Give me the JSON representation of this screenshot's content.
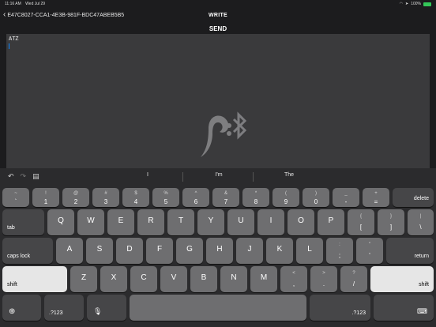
{
  "status": {
    "time": "11:16 AM",
    "date": "Wed Jul 29",
    "battery": "100%"
  },
  "nav": {
    "back_label": "E47C8027-CCA1-4E3B-981F-BDC47ABEB5B5",
    "title": "WRITE"
  },
  "send_label": "SEND",
  "editor": {
    "text": "ATZ"
  },
  "suggestions": [
    "I",
    "I'm",
    "The"
  ],
  "keyboard": {
    "row1": [
      {
        "t": "~",
        "b": "`"
      },
      {
        "t": "!",
        "b": "1"
      },
      {
        "t": "@",
        "b": "2"
      },
      {
        "t": "#",
        "b": "3"
      },
      {
        "t": "$",
        "b": "4"
      },
      {
        "t": "%",
        "b": "5"
      },
      {
        "t": "^",
        "b": "6"
      },
      {
        "t": "&",
        "b": "7"
      },
      {
        "t": "*",
        "b": "8"
      },
      {
        "t": "(",
        "b": "9"
      },
      {
        "t": ")",
        "b": "0"
      },
      {
        "t": "_",
        "b": "-"
      },
      {
        "t": "+",
        "b": "="
      }
    ],
    "delete": "delete",
    "tab": "tab",
    "row2": [
      "Q",
      "W",
      "E",
      "R",
      "T",
      "Y",
      "U",
      "I",
      "O",
      "P"
    ],
    "row2_sym": [
      {
        "t": "{",
        "b": "["
      },
      {
        "t": "}",
        "b": "]"
      },
      {
        "t": "|",
        "b": "\\"
      }
    ],
    "caps": "caps lock",
    "row3": [
      "A",
      "S",
      "D",
      "F",
      "G",
      "H",
      "J",
      "K",
      "L"
    ],
    "row3_sym": [
      {
        "t": ":",
        "b": ";"
      },
      {
        "t": "\"",
        "b": "'"
      }
    ],
    "return": "return",
    "shift": "shift",
    "row4": [
      "Z",
      "X",
      "C",
      "V",
      "B",
      "N",
      "M"
    ],
    "row4_sym": [
      {
        "t": "<",
        "b": ","
      },
      {
        "t": ">",
        "b": "."
      },
      {
        "t": "?",
        "b": "/"
      }
    ],
    "num": ".?123",
    "globe_icon": "globe-icon",
    "mic_icon": "microphone-icon"
  }
}
